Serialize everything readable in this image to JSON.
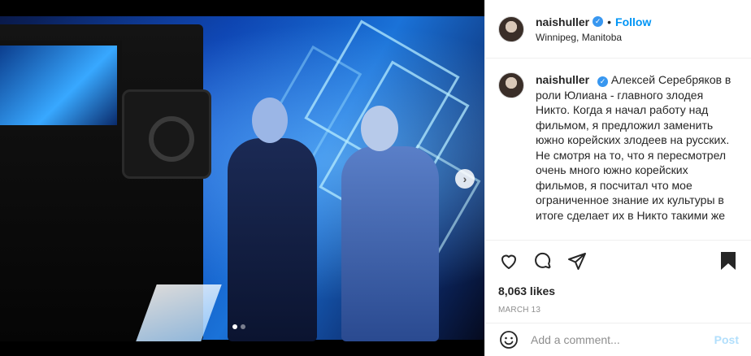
{
  "post": {
    "username": "naishuller",
    "verified_icon": "verified-badge-icon",
    "separator": "•",
    "follow_label": "Follow",
    "location": "Winnipeg, Manitoba"
  },
  "caption": {
    "username": "naishuller",
    "text": "Алексей Серебряков в роли Юлиана - главного злодея Никто. Когда я начал работу над фильмом, я предложил заменить южно корейских злодеев на русских. Не смотря на то, что я пересмотрел очень много южно корейских фильмов, я посчитал что мое ограниченное знание их культуры в итоге сделает их в Никто такими же"
  },
  "actions": {
    "like_icon": "heart-icon",
    "comment_icon": "comment-icon",
    "share_icon": "share-icon",
    "save_icon": "bookmark-icon",
    "likes": "8,063 likes",
    "date": "MARCH 13"
  },
  "comment": {
    "emoji_icon": "emoji-icon",
    "placeholder": "Add a comment...",
    "post_label": "Post"
  },
  "carousel": {
    "next_icon": "chevron-right-icon",
    "next_glyph": "›",
    "slide_count": 2,
    "active_index": 0
  },
  "colors": {
    "follow": "#0095f6",
    "verified": "#3897f0",
    "post_disabled": "#b2dffc"
  }
}
